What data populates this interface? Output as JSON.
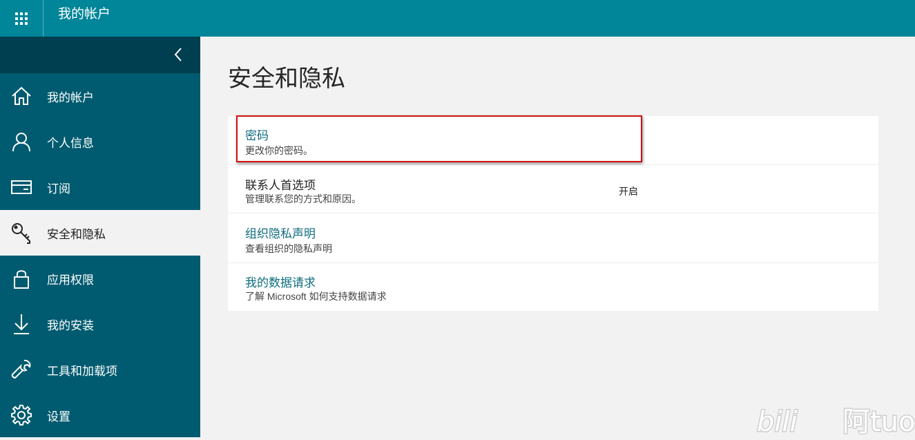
{
  "header": {
    "app_title": "我的帐户",
    "launcher_icon": "app-launcher-icon",
    "background": "#008599"
  },
  "sidebar": {
    "collapse_icon": "chevron-left-icon",
    "items": [
      {
        "label": "我的帐户",
        "icon": "home-icon"
      },
      {
        "label": "个人信息",
        "icon": "person-icon"
      },
      {
        "label": "订阅",
        "icon": "card-icon"
      },
      {
        "label": "安全和隐私",
        "icon": "key-icon",
        "active": true
      },
      {
        "label": "应用权限",
        "icon": "lock-icon"
      },
      {
        "label": "我的安装",
        "icon": "download-icon"
      },
      {
        "label": "工具和加载项",
        "icon": "wrench-icon"
      },
      {
        "label": "设置",
        "icon": "gear-icon"
      }
    ],
    "background": "#005b70",
    "active_background": "#f2f2f2"
  },
  "main": {
    "page_title": "安全和隐私",
    "rows": [
      {
        "title": "密码",
        "subtitle": "更改你的密码。",
        "status": ""
      },
      {
        "title": "联系人首选项",
        "subtitle": "管理联系您的方式和原因。",
        "status": "开启"
      },
      {
        "title": "组织隐私声明",
        "subtitle": "查看组织的隐私声明",
        "status": ""
      },
      {
        "title": "我的数据请求",
        "subtitle": "了解 Microsoft 如何支持数据请求",
        "status": ""
      }
    ],
    "link_color": "#0f6c7e",
    "highlight_color": "#d21010"
  },
  "watermark": {
    "text": "bilibili 阿tuo"
  }
}
